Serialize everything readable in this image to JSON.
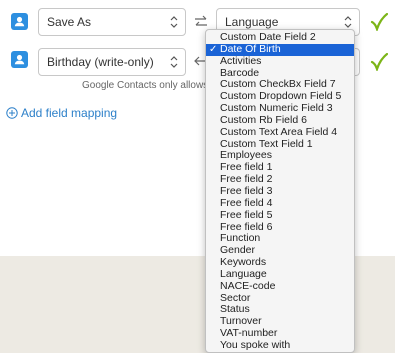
{
  "mappings": [
    {
      "source": "Save As",
      "destination": "Language",
      "direction": "swap"
    },
    {
      "source": "Birthday (write-only)",
      "destination": "",
      "direction": "left"
    }
  ],
  "helper_text": "Google Contacts only allows writing t",
  "add_field_mapping": "Add field mapping",
  "dropdown": {
    "selected": "Date Of Birth",
    "items": [
      "Custom Date Field 2",
      "Date Of Birth",
      "Activities",
      "Barcode",
      "Custom CheckBx Field 7",
      "Custom Dropdown Field 5",
      "Custom Numeric Field 3",
      "Custom Rb Field 6",
      "Custom Text Area Field 4",
      "Custom Text Field 1",
      "Employees",
      "Free field 1",
      "Free field 2",
      "Free field 3",
      "Free field 4",
      "Free field 5",
      "Free field 6",
      "Function",
      "Gender",
      "Keywords",
      "Language",
      "NACE-code",
      "Sector",
      "Status",
      "Turnover",
      "VAT-number",
      "You spoke with"
    ]
  },
  "colors": {
    "contact_icon": "#2d8fe0",
    "check_icon": "#7cb518",
    "link": "#2d80c9",
    "selected_item": "#1a63d6",
    "footer_background": "#edeae3"
  },
  "icons": {
    "contact": "contact-card-icon",
    "swap": "swap-arrows-icon",
    "left_arrow": "left-arrow-icon",
    "check": "checkmark-icon",
    "add": "plus-circle-icon"
  }
}
